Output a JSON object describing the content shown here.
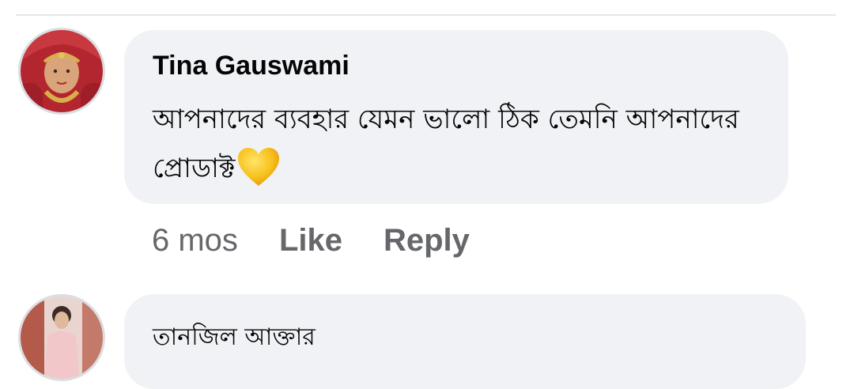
{
  "comments": [
    {
      "author": "Tina Gauswami",
      "text": "আপনাদের ব্যবহার যেমন ভালো ঠিক তেমনি আপনাদের প্রোডাক্ট",
      "emoji": "yellow-heart",
      "time": "6 mos",
      "like_label": "Like",
      "reply_label": "Reply"
    },
    {
      "author": "তানজিল আক্তার"
    }
  ],
  "colors": {
    "bubble": "#f0f2f5",
    "divider": "#e4e6eb",
    "secondary_text": "#65676b",
    "primary_text": "#050505",
    "heart": "#f7c21e"
  }
}
